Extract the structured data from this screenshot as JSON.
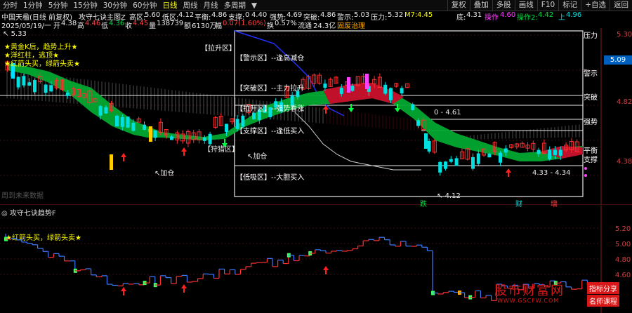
{
  "toolbar": {
    "tabs": [
      "分时",
      "1分钟",
      "5分钟",
      "15分钟",
      "30分钟",
      "60分钟",
      "日线",
      "周线",
      "月线",
      "多周期"
    ],
    "active_tab": "日线",
    "right_buttons": [
      "复权",
      "叠加",
      "多股",
      "画线",
      "F10",
      "标记",
      "+自选",
      "返回"
    ]
  },
  "info_row": {
    "stock": "中国天楹(日线 前复权)",
    "indicator": "攻守七诀主图Z",
    "items": [
      {
        "label": "高区:",
        "value": "5.60"
      },
      {
        "label": "低区:",
        "value": "4.12"
      },
      {
        "label": "平衡:",
        "value": "4.86"
      },
      {
        "label": "支撑:",
        "value": "0"
      },
      {
        "label": "",
        "value": "4.40"
      },
      {
        "label": "强势:",
        "value": "4.69"
      },
      {
        "label": "突破:",
        "value": "4.86"
      },
      {
        "label": "警示:",
        "value": "5.03"
      },
      {
        "label": "压力:",
        "value": "5.32"
      },
      {
        "label": "M7:",
        "value": "4.45"
      },
      {
        "label": "底:",
        "value": "4.31"
      },
      {
        "label": "操作",
        "value": "4.60"
      },
      {
        "label": "操作2:",
        "value": "4.42"
      },
      {
        "label": "上",
        "value": "4.96"
      }
    ]
  },
  "ohlc_row": {
    "date": "2025/05/19/一",
    "open_label": "开",
    "open": "4.38",
    "high_label": "高",
    "high": "4.46",
    "low_label": "低",
    "low": "4.36",
    "close_label": "收",
    "close": "4.45",
    "volume_label": "量",
    "volume": "138739",
    "amount_label": "额",
    "amount": "6130万",
    "change_label": "幅",
    "change": "0.07(1.60%)",
    "turnover_label": "换",
    "turnover": "0.57%",
    "float_label": "流通",
    "float": "24.3亿",
    "concept": "固废治理"
  },
  "main_chart": {
    "high_marker": "5.33",
    "low_marker": "4.12",
    "range_marker": "4.33 - 4.34",
    "level_marker": "4.61",
    "legend": [
      "★黄金K后，趋势上升★",
      "★洋红柱，逃顶★",
      "★红箭头买，绿箭头卖★"
    ],
    "annotations": [
      "加仓",
      "加仓",
      "狩猎区"
    ],
    "bottom_tags": [
      "跌",
      "财",
      "增"
    ],
    "no_data_text": "周到未来数据",
    "current_price": "5.09",
    "y_ticks": [
      "5.30",
      "4.82",
      "4.38"
    ],
    "zones": [
      {
        "name": "拉升区",
        "desc": ""
      },
      {
        "name": "警示区",
        "desc": "--逢高减仓"
      },
      {
        "name": "突破区",
        "desc": "--主力拉升"
      },
      {
        "name": "拉升区",
        "desc": "--强势看涨"
      },
      {
        "name": "支撑区",
        "desc": "--逢低买入"
      },
      {
        "name": "低吸区",
        "desc": "--大胆买入"
      }
    ],
    "right_tags": [
      "压力",
      "警示",
      "突破",
      "强势",
      "平衡",
      "支撑"
    ]
  },
  "sub_chart": {
    "title": "攻守七诀趋势F",
    "legend": "★红箭头买，绿箭头卖★",
    "y_ticks": [
      "5.20",
      "5.00",
      "4.80",
      "4.60"
    ]
  },
  "watermark": {
    "site_name": "股市财富网",
    "url": "WWW.GSCFW.COM",
    "badge1": "指标分享",
    "badge2": "名师课程"
  },
  "colors": {
    "up": "#ff4040",
    "down": "#00e0e0",
    "bull_band": "#00a030",
    "bear_band": "#c01030",
    "axis": "#d04040"
  }
}
